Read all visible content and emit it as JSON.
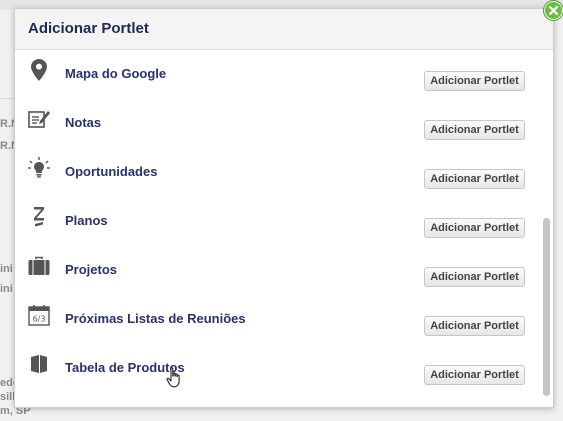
{
  "background": {
    "snippets": [
      "R.N",
      "R.N",
      "ini",
      "ini",
      "edo",
      "sill",
      "m, SP"
    ]
  },
  "dialog": {
    "title": "Adicionar Portlet",
    "close_icon": "close-icon"
  },
  "portlets": [
    {
      "name": "Mapa do Google",
      "icon": "map-pin-icon",
      "button": "Adicionar Portlet"
    },
    {
      "name": "Notas",
      "icon": "note-pencil-icon",
      "button": "Adicionar Portlet"
    },
    {
      "name": "Oportunidades",
      "icon": "lightbulb-icon",
      "button": "Adicionar Portlet"
    },
    {
      "name": "Planos",
      "icon": "zeta-icon",
      "button": "Adicionar Portlet"
    },
    {
      "name": "Projetos",
      "icon": "briefcase-icon",
      "button": "Adicionar Portlet"
    },
    {
      "name": "Próximas Listas de Reuniões",
      "icon": "calendar-icon",
      "button": "Adicionar Portlet",
      "icon_text": "6/3"
    },
    {
      "name": "Tabela de Produtos",
      "icon": "book-icon",
      "button": "Adicionar Portlet"
    }
  ],
  "scrollbar": {
    "position": 0.96
  },
  "colors": {
    "title": "#1e2a55",
    "label": "#2a3170",
    "close": "#6cbc3f"
  }
}
